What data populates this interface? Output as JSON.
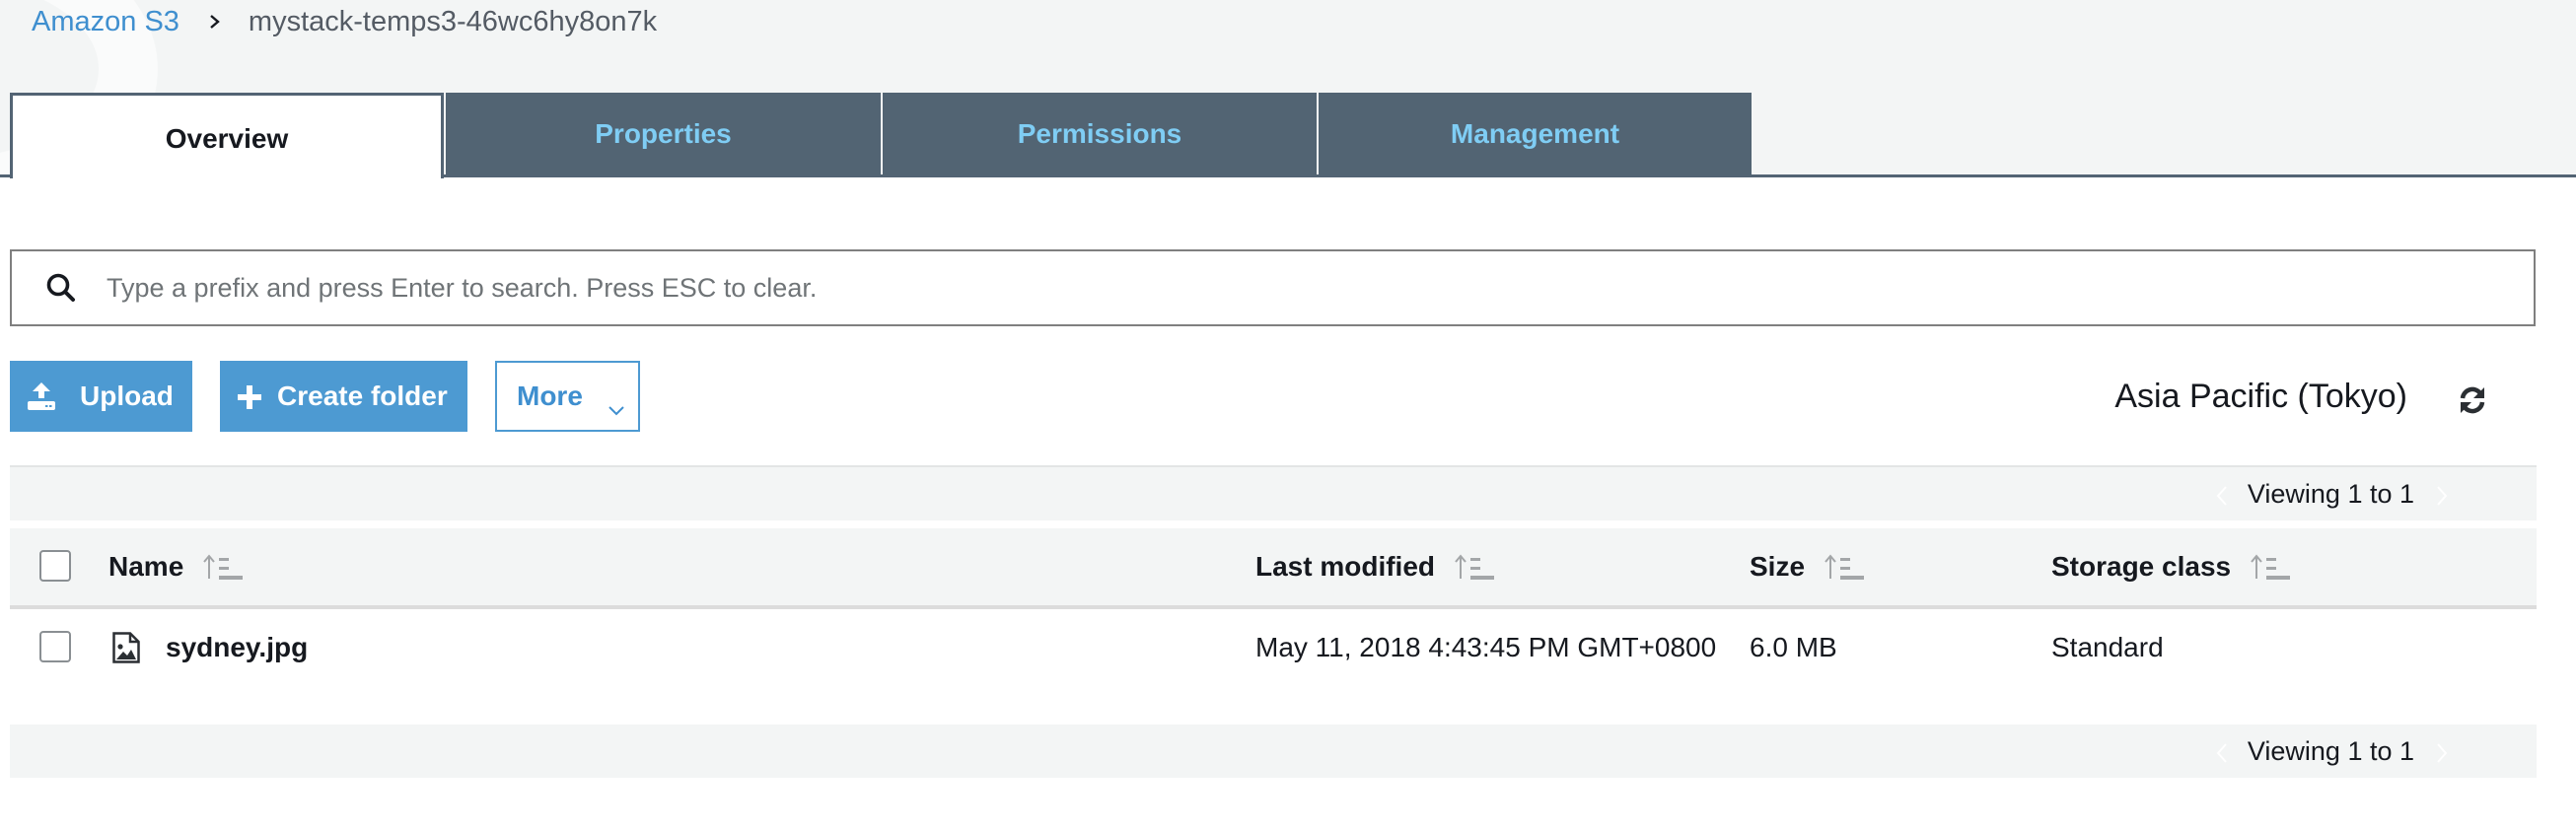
{
  "breadcrumb": {
    "root": "Amazon S3",
    "separator_icon": "chevron-right-icon",
    "current": "mystack-temps3-46wc6hy8on7k"
  },
  "tabs": [
    {
      "label": "Overview",
      "active": true
    },
    {
      "label": "Properties",
      "active": false
    },
    {
      "label": "Permissions",
      "active": false
    },
    {
      "label": "Management",
      "active": false
    }
  ],
  "search": {
    "icon": "search-icon",
    "value": "",
    "placeholder": "Type a prefix and press Enter to search. Press ESC to clear."
  },
  "actions": {
    "upload_label": "Upload",
    "upload_icon": "upload-icon",
    "create_folder_label": "Create folder",
    "create_folder_icon": "plus-icon",
    "more_label": "More",
    "more_icon": "chevron-down-icon"
  },
  "region": {
    "label": "Asia Pacific (Tokyo)",
    "refresh_icon": "refresh-icon"
  },
  "pagination": {
    "top_label": "Viewing 1 to 1",
    "bottom_label": "Viewing 1 to 1"
  },
  "table": {
    "columns": [
      {
        "label": "Name",
        "sortable": true
      },
      {
        "label": "Last modified",
        "sortable": true
      },
      {
        "label": "Size",
        "sortable": true
      },
      {
        "label": "Storage class",
        "sortable": true
      }
    ],
    "rows": [
      {
        "name": "sydney.jpg",
        "type_icon": "image-file-icon",
        "last_modified": "May 11, 2018 4:43:45 PM GMT+0800",
        "size": "6.0 MB",
        "storage_class": "Standard",
        "selected": false
      }
    ]
  },
  "colors": {
    "primary_blue": "#4d9ad2",
    "link_blue": "#3f8fcf",
    "tab_inactive_bg": "#526473",
    "tab_inactive_text": "#7fcdf4",
    "page_band": "#f3f5f5"
  }
}
